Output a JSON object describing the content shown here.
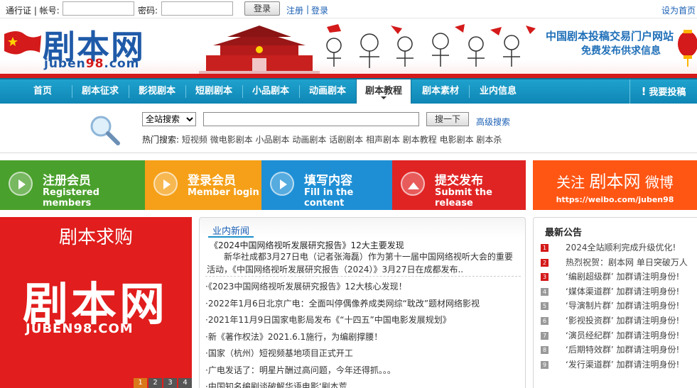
{
  "topbar": {
    "passport_label": "通行证 | 帐号:",
    "password_label": "密码:",
    "login_button": "登录",
    "register_link": "注册",
    "separator": "|",
    "login_link": "登录",
    "homepage_link": "设为首页"
  },
  "header": {
    "logo_text": "剧本网",
    "logo_domain_prefix": "juben",
    "logo_domain_num": "98",
    "logo_domain_suffix": ".com",
    "slogan_line1": "中国剧本投稿交易门户网站",
    "slogan_line2": "免费发布供求信息"
  },
  "nav": {
    "items": [
      {
        "label": "首页"
      },
      {
        "label": "剧本征求"
      },
      {
        "label": "影视剧本"
      },
      {
        "label": "短剧剧本"
      },
      {
        "label": "小品剧本"
      },
      {
        "label": "动画剧本"
      },
      {
        "label": "剧本教程"
      },
      {
        "label": "剧本素材"
      },
      {
        "label": "业内信息"
      }
    ],
    "active_index": 6,
    "post_button": "我要投稿"
  },
  "search": {
    "scope_selected": "全站搜索",
    "button": "搜一下",
    "advanced_link": "高级搜索",
    "hot_label": "热门搜索:",
    "hot_terms": "短视频 微电影剧本 小品剧本 动画剧本 话剧剧本 相声剧本 剧本教程 电影剧本 剧本杀"
  },
  "steps": [
    {
      "title": "注册会员",
      "subtitle": "Registered members",
      "color": "#4aa02c"
    },
    {
      "title": "登录会员",
      "subtitle": "Member login",
      "color": "#f5a018"
    },
    {
      "title": "填写内容",
      "subtitle": "Fill in the content",
      "color": "#1e8fd5"
    },
    {
      "title": "提交发布",
      "subtitle": "Submit the release",
      "color": "#e02424"
    }
  ],
  "weibo": {
    "follow": "关注",
    "name": "剧本网",
    "suffix": "微博",
    "url": "https://weibo.com/juben98"
  },
  "ad": {
    "title": "剧本求购",
    "logo_text": "剧本网",
    "url_text": "JUBEN98.COM",
    "pages": [
      "1",
      "2",
      "3",
      "4"
    ]
  },
  "news": {
    "tab": "业内新闻",
    "headline": "《2024中国网络视听发展研究报告》12大主要发现",
    "summary": "新华社成都3月27日电（记者张海磊）作为第十一届中国网络视听大会的重要活动，《中国网络视听发展研究报告（2024）》3月27日在成都发布..",
    "items": [
      "·《2023中国网络视听发展研究报告》12大核心发现！",
      "·2022年1月6日北京广电：全面叫停偶像养成类网综“耽改”题材网络影视",
      "·2021年11月9日国家电影局发布《“十四五”中国电影发展规划》",
      "·新《著作权法》2021.6.1施行，为编剧撑腰！",
      "·国家（杭州）短视频基地项目正式开工",
      "·广电发话了：明星片酬过高问题，今年还得抓。。。",
      "·中国知名编剧谈破解华语电影‘剧本荒"
    ]
  },
  "notices": {
    "title": "最新公告",
    "items": [
      {
        "num": "1",
        "text": "2024全站顺利完成升级优化!"
      },
      {
        "num": "2",
        "text": "热烈祝贺：剧本网 单日突破万人"
      },
      {
        "num": "3",
        "text": "‘编剧超级群’ 加群请注明身份!"
      },
      {
        "num": "4",
        "text": "‘媒体渠道群’ 加群请注明身份!"
      },
      {
        "num": "5",
        "text": "‘导演制片群’ 加群请注明身份!"
      },
      {
        "num": "6",
        "text": "‘影视投资群’ 加群请注明身份!"
      },
      {
        "num": "7",
        "text": "‘演员经纪群’ 加群请注明身份!"
      },
      {
        "num": "8",
        "text": "‘后期特效群’ 加群请注明身份!"
      },
      {
        "num": "9",
        "text": "‘发行渠道群’ 加群请注明身份!"
      }
    ]
  }
}
